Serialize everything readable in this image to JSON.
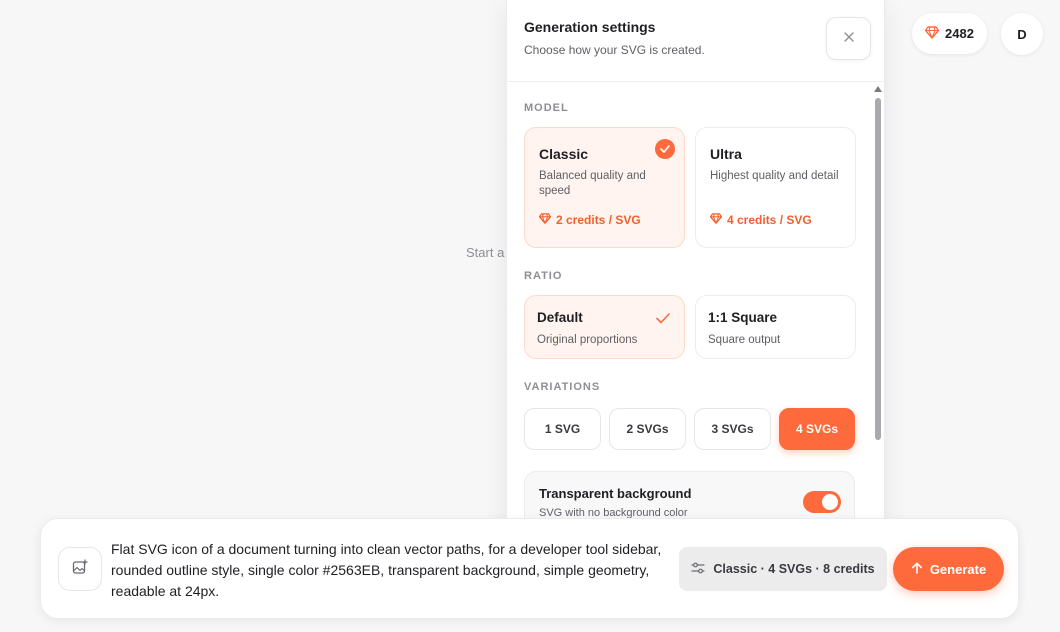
{
  "background": {
    "hint_text": "Start a"
  },
  "credits": {
    "balance": "2482"
  },
  "user": {
    "initial": "D"
  },
  "settings": {
    "title": "Generation settings",
    "subtitle": "Choose how your SVG is created.",
    "model_label": "MODEL",
    "models": [
      {
        "name": "Classic",
        "description": "Balanced quality and speed",
        "cost": "2 credits / SVG",
        "selected": true
      },
      {
        "name": "Ultra",
        "description": "Highest quality and detail",
        "cost": "4 credits / SVG",
        "selected": false
      }
    ],
    "ratio_label": "RATIO",
    "ratios": [
      {
        "name": "Default",
        "description": "Original proportions",
        "selected": true
      },
      {
        "name": "1:1 Square",
        "description": "Square output",
        "selected": false
      }
    ],
    "variations_label": "VARIATIONS",
    "variations": [
      {
        "label": "1 SVG",
        "selected": false
      },
      {
        "label": "2 SVGs",
        "selected": false
      },
      {
        "label": "3 SVGs",
        "selected": false
      },
      {
        "label": "4 SVGs",
        "selected": true
      }
    ],
    "transparent": {
      "title": "Transparent background",
      "description": "SVG with no background color",
      "enabled": true
    }
  },
  "prompt": {
    "text": "Flat SVG icon of a document turning into clean vector paths, for a developer tool sidebar, rounded outline style, single color #2563EB, transparent background, simple geometry, readable at 24px.",
    "summary": "Classic · 4 SVGs · 8 credits",
    "generate_label": "Generate"
  },
  "colors": {
    "accent": "#ff6a3d",
    "accent_text": "#f0602e",
    "selected_bg": "#fff4ef"
  }
}
